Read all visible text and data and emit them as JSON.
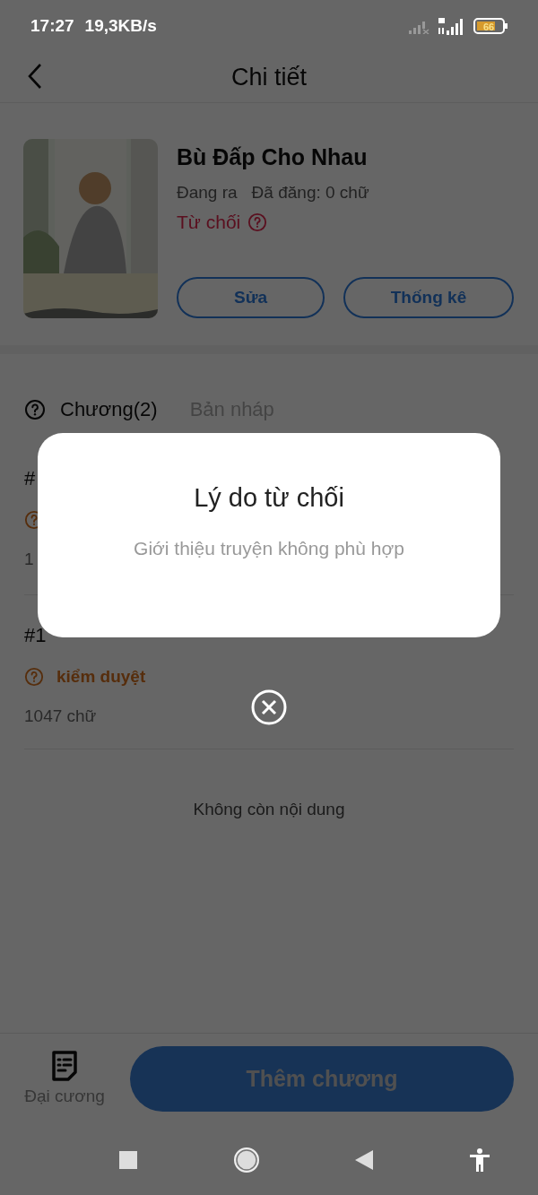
{
  "status_bar": {
    "time": "17:27",
    "speed": "19,3KB/s",
    "battery": "66"
  },
  "header": {
    "title": "Chi tiết"
  },
  "book": {
    "title": "Bù Đấp Cho Nhau",
    "status": "Đang ra",
    "published": "Đã đăng: 0 chữ",
    "review": "Từ chối",
    "buttons": [
      "Sửa",
      "Thống kê"
    ]
  },
  "tabs": [
    {
      "label": "Chương(2)",
      "selected": true
    },
    {
      "label": "Bản nháp",
      "selected": false
    }
  ],
  "chapters": [
    {
      "number": "#",
      "words": "1"
    },
    {
      "number": "#1",
      "status": "kiểm duyệt",
      "words": "1047 chữ"
    }
  ],
  "end_note": "Không còn nội dung",
  "bottom_bar": {
    "outline_label": "Đại cương",
    "add_button": "Thêm chương"
  },
  "dialog": {
    "title": "Lý do từ chối",
    "message": "Giới thiệu truyện không phù hợp"
  }
}
